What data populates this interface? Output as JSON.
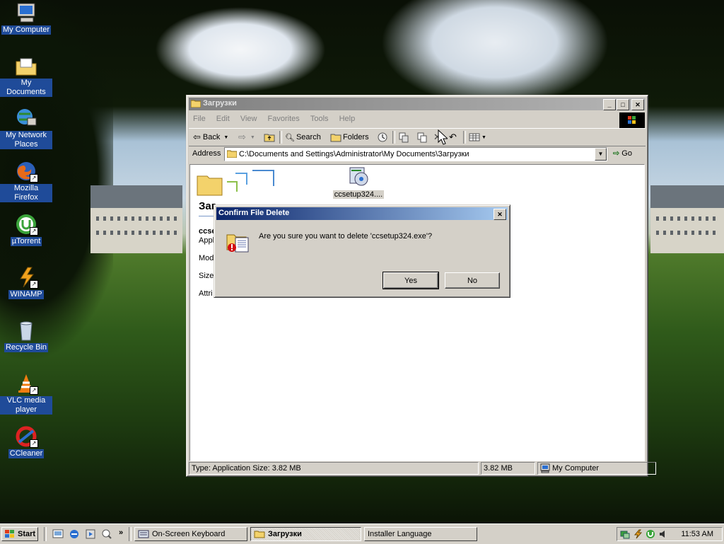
{
  "desktop": {
    "icons": [
      {
        "label": "My Computer",
        "icon": "my-computer-icon"
      },
      {
        "label": "My Documents",
        "icon": "my-documents-icon"
      },
      {
        "label": "My Network Places",
        "icon": "network-places-icon"
      },
      {
        "label": "Mozilla Firefox",
        "icon": "firefox-icon"
      },
      {
        "label": "µTorrent",
        "icon": "utorrent-icon"
      },
      {
        "label": "WINAMP",
        "icon": "winamp-icon"
      },
      {
        "label": "Recycle Bin",
        "icon": "recycle-bin-icon"
      },
      {
        "label": "VLC media player",
        "icon": "vlc-icon"
      },
      {
        "label": "CCleaner",
        "icon": "ccleaner-icon"
      }
    ]
  },
  "explorer": {
    "title": "Загрузки",
    "menu": [
      "File",
      "Edit",
      "View",
      "Favorites",
      "Tools",
      "Help"
    ],
    "toolbar": {
      "back": "Back",
      "search": "Search",
      "folders": "Folders"
    },
    "address_label": "Address",
    "address_value": "C:\\Documents and Settings\\Administrator\\My Documents\\Загрузки",
    "go_label": "Go",
    "side_title": "Заг",
    "side_file_name": "ccse",
    "side_file_type": "Appl",
    "side_modified": "Modi",
    "side_size": "Size:",
    "side_attr": "Attri",
    "file_label": "ccsetup324....",
    "status": {
      "left": "Type: Application Size: 3.82 MB",
      "mid": "3.82 MB",
      "right": "My Computer"
    }
  },
  "dialog": {
    "title": "Confirm File Delete",
    "message": "Are you sure you want to delete 'ccsetup324.exe'?",
    "yes": "Yes",
    "no": "No"
  },
  "taskbar": {
    "start": "Start",
    "tasks": [
      {
        "label": "On-Screen Keyboard",
        "active": false
      },
      {
        "label": "Загрузки",
        "active": true
      },
      {
        "label": "Installer Language",
        "active": false
      }
    ],
    "clock": "11:53 AM"
  },
  "colors": {
    "titlebar_active": "#0a246a",
    "titlebar_inactive": "#808080",
    "face": "#d4d0c8",
    "selection": "#1f4b99"
  }
}
